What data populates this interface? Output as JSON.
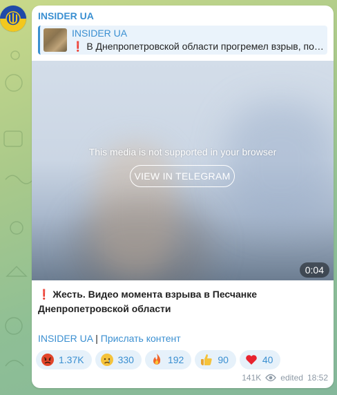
{
  "channel": {
    "name": "INSIDER UA"
  },
  "reply": {
    "title": "INSIDER UA",
    "text": "❗ В Днепропетровской области прогремел взрыв, по…"
  },
  "media": {
    "unsupported_text": "This media is not supported in your browser",
    "button_label": "VIEW IN TELEGRAM",
    "duration": "0:04"
  },
  "caption": "❗ Жесть. Видео момента взрыва в Песчанке Днепропетровской области",
  "links": {
    "channel": "INSIDER UA",
    "separator": " | ",
    "send_content": "Прислать контент"
  },
  "reactions": [
    {
      "emoji": "angry-face-icon",
      "count": "1.37K"
    },
    {
      "emoji": "crying-face-icon",
      "count": "330"
    },
    {
      "emoji": "fire-icon",
      "count": "192"
    },
    {
      "emoji": "thumbs-up-icon",
      "count": "90"
    },
    {
      "emoji": "red-heart-icon",
      "count": "40"
    }
  ],
  "footer": {
    "views": "141K",
    "edited": "edited",
    "time": "18:52"
  },
  "colors": {
    "accent": "#3a8fd1",
    "bubble": "#ffffff",
    "reaction_bg": "#e6f1fa"
  }
}
